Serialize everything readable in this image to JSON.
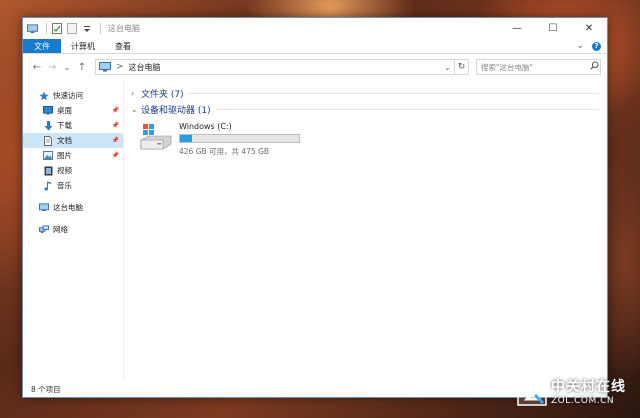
{
  "window": {
    "title": "这台电脑",
    "controls": {
      "minimize": "—",
      "maximize": "☐",
      "close": "✕"
    }
  },
  "ribbon": {
    "tabs": [
      {
        "label": "文件",
        "active": true
      },
      {
        "label": "计算机",
        "active": false
      },
      {
        "label": "查看",
        "active": false
      }
    ],
    "expand_glyph": "⌄",
    "help_glyph": "?"
  },
  "address": {
    "back": "←",
    "forward": "→",
    "recent": "⌄",
    "up": "↑",
    "crumbs": [
      "这台电脑"
    ],
    "separator": ">",
    "dropdown": "⌄",
    "refresh": "↻"
  },
  "search": {
    "placeholder": "搜索\"这台电脑\""
  },
  "nav": {
    "quick_access": "快速访问",
    "items": [
      {
        "label": "桌面",
        "icon": "desktop-icon",
        "pinned": true
      },
      {
        "label": "下载",
        "icon": "download-icon",
        "pinned": true
      },
      {
        "label": "文档",
        "icon": "document-icon",
        "pinned": true,
        "selected": true
      },
      {
        "label": "图片",
        "icon": "pictures-icon",
        "pinned": true
      },
      {
        "label": "视频",
        "icon": "video-icon",
        "pinned": false
      },
      {
        "label": "音乐",
        "icon": "music-icon",
        "pinned": false
      }
    ],
    "this_pc": "这台电脑",
    "network": "网络"
  },
  "content": {
    "folders_header": "文件夹 (7)",
    "devices_header": "设备和驱动器 (1)",
    "drive": {
      "name": "Windows (C:)",
      "free_text": "426 GB 可用，共 475 GB",
      "used_fraction": 0.103
    }
  },
  "status": {
    "item_count": "8 个项目"
  },
  "watermark": {
    "brand_cn": "中关村在线",
    "brand_en": "ZOL.COM.CN"
  },
  "colors": {
    "accent": "#1979ca",
    "selection": "#cce6f7",
    "drive_fill": "#26a0da",
    "header_text": "#1e3b8c"
  }
}
